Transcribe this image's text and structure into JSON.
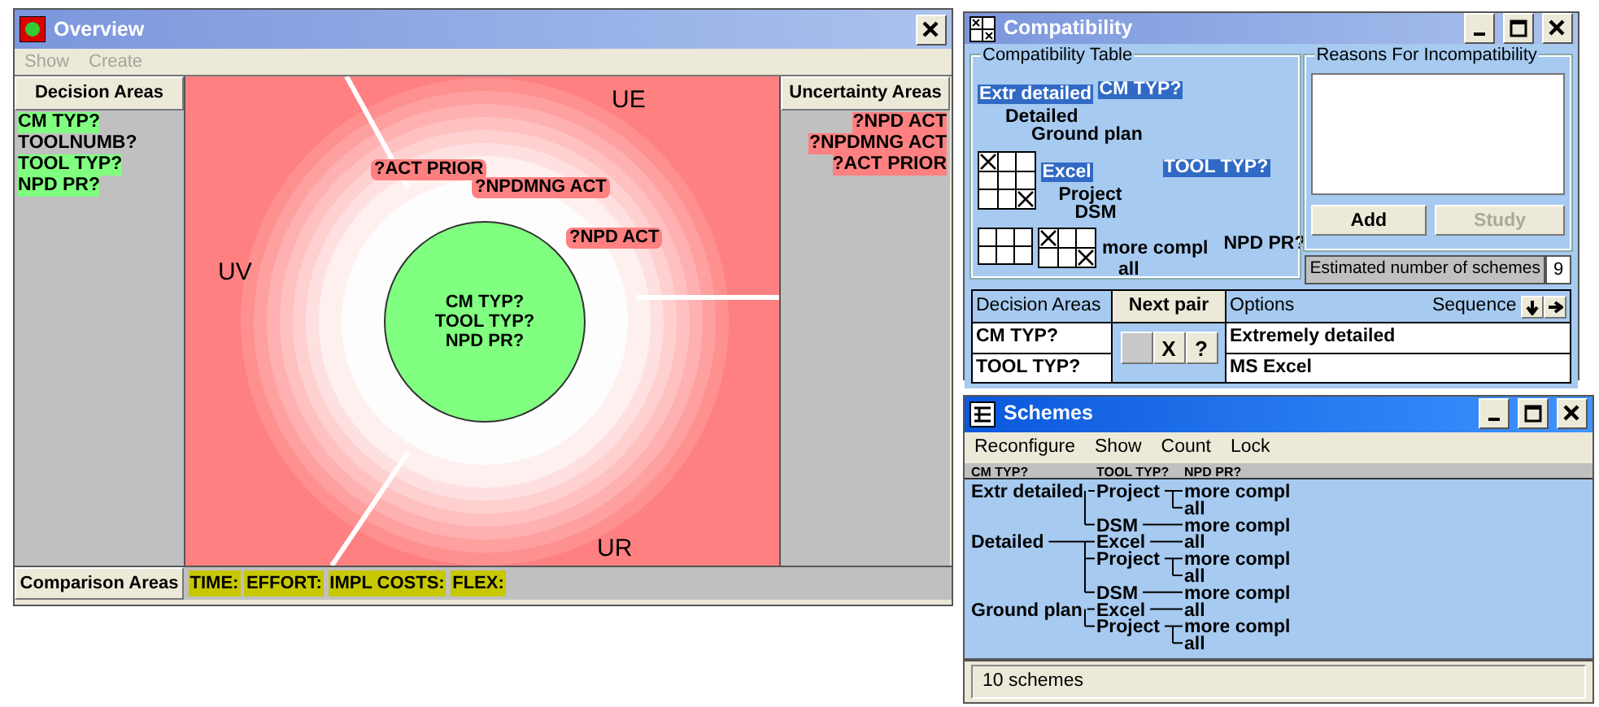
{
  "overview": {
    "title": "Overview",
    "menu": [
      {
        "label": "Show",
        "disabled": true
      },
      {
        "label": "Create",
        "disabled": true
      }
    ],
    "decision_areas": {
      "heading": "Decision Areas",
      "items": [
        {
          "label": "CM TYP?",
          "selected": true
        },
        {
          "label": "TOOLNUMB?",
          "selected": false
        },
        {
          "label": "TOOL TYP?",
          "selected": true
        },
        {
          "label": "NPD PR?",
          "selected": true
        }
      ]
    },
    "focus": {
      "sectors": [
        "UE",
        "UV",
        "UR"
      ],
      "core": [
        "CM TYP?",
        "TOOL TYP?",
        "NPD PR?"
      ],
      "uncertainties": [
        "?ACT PRIOR",
        "?NPDMNG ACT",
        "?NPD ACT"
      ]
    },
    "uncertainty_areas": {
      "heading": "Uncertainty Areas",
      "items": [
        "?NPD ACT",
        "?NPDMNG ACT",
        "?ACT PRIOR"
      ]
    },
    "comparison_areas": {
      "heading": "Comparison Areas",
      "items": [
        "TIME:",
        "EFFORT:",
        "IMPL COSTS:",
        "FLEX:"
      ]
    }
  },
  "compatibility": {
    "title": "Compatibility",
    "table": {
      "title": "Compatibility Table",
      "rows": [
        {
          "area": {
            "label": "CM TYP?",
            "selected": true
          },
          "options": [
            {
              "label": "Extr detailed",
              "selected": true
            },
            {
              "label": "Detailed",
              "selected": false
            },
            {
              "label": "Ground plan",
              "selected": false
            }
          ]
        },
        {
          "area": {
            "label": "TOOL TYP?",
            "selected": true
          },
          "options": [
            {
              "label": "Excel",
              "selected": true
            },
            {
              "label": "Project",
              "selected": false
            },
            {
              "label": "DSM",
              "selected": false
            }
          ],
          "grids": [
            [
              [
                true,
                false,
                false
              ],
              [
                false,
                false,
                false
              ],
              [
                false,
                false,
                true
              ]
            ]
          ]
        },
        {
          "area": {
            "label": "NPD PR?",
            "selected": false
          },
          "options": [
            {
              "label": "more compl",
              "selected": false
            },
            {
              "label": "all",
              "selected": false
            }
          ],
          "grids": [
            [
              [
                false,
                false,
                false
              ],
              [
                false,
                false,
                false
              ]
            ],
            [
              [
                true,
                false,
                false
              ],
              [
                false,
                false,
                true
              ]
            ]
          ]
        }
      ]
    },
    "reasons": {
      "title": "Reasons For Incompatibility",
      "buttons": [
        {
          "label": "Add",
          "disabled": false
        },
        {
          "label": "Study",
          "disabled": true
        }
      ]
    },
    "estimate": {
      "label": "Estimated number of schemes",
      "value": "9"
    },
    "pairs": {
      "areas_heading": "Decision Areas",
      "next_button": "Next pair",
      "options_heading": "Options",
      "sequence_label": "Sequence",
      "rows": [
        {
          "area": "CM TYP?",
          "option": "Extremely detailed"
        },
        {
          "area": "TOOL TYP?",
          "option": "MS Excel"
        }
      ],
      "pair_buttons": [
        "X",
        "?"
      ]
    }
  },
  "schemes": {
    "title": "Schemes",
    "menu": [
      "Reconfigure",
      "Show",
      "Count",
      "Lock"
    ],
    "columns": [
      "CM TYP?",
      "TOOL TYP?",
      "NPD PR?"
    ],
    "tree": [
      {
        "label": "Extr detailed",
        "children": [
          {
            "label": "Project",
            "children": [
              {
                "label": "more compl"
              },
              {
                "label": "all"
              }
            ]
          },
          {
            "label": "DSM",
            "children": [
              {
                "label": "more compl"
              }
            ]
          }
        ]
      },
      {
        "label": "Detailed",
        "children": [
          {
            "label": "Excel",
            "children": [
              {
                "label": "all"
              }
            ]
          },
          {
            "label": "Project",
            "children": [
              {
                "label": "more compl"
              },
              {
                "label": "all"
              }
            ]
          },
          {
            "label": "DSM",
            "children": [
              {
                "label": "more compl"
              }
            ]
          }
        ]
      },
      {
        "label": "Ground plan",
        "children": [
          {
            "label": "Excel",
            "children": [
              {
                "label": "all"
              }
            ]
          },
          {
            "label": "Project",
            "children": [
              {
                "label": "more compl"
              },
              {
                "label": "all"
              }
            ]
          }
        ]
      }
    ],
    "status": "10 schemes"
  }
}
